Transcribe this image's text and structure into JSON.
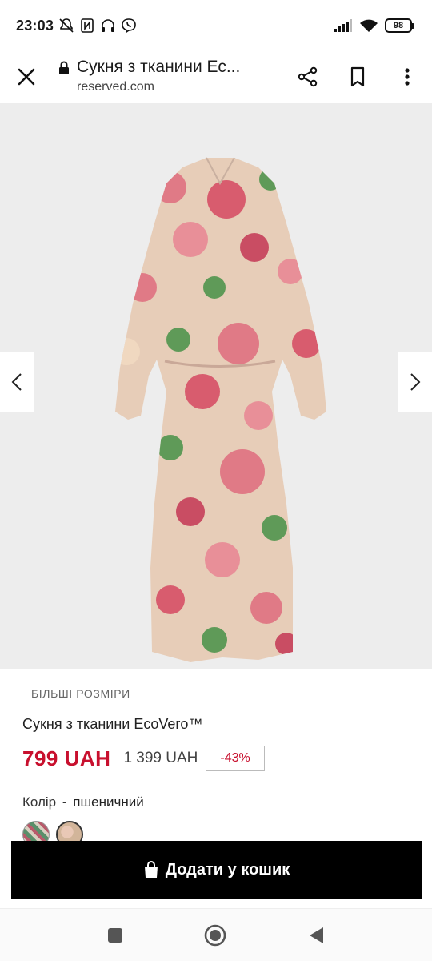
{
  "status_bar": {
    "time": "23:03",
    "battery": "98"
  },
  "browser": {
    "page_title": "Сукня з тканини Ес...",
    "domain": "reserved.com"
  },
  "product": {
    "category_label": "БІЛЬШІ РОЗМІРИ",
    "name": "Сукня з тканини EcoVero™",
    "price": "799 UAH",
    "old_price": "1 399 UAH",
    "discount": "-43%",
    "color_label": "Колір",
    "color_separator": "-",
    "color_value": "пшеничний"
  },
  "cart_button": {
    "label": "Додати у кошик"
  },
  "icons": {
    "close": "close-icon",
    "lock": "lock-icon",
    "share": "share-icon",
    "bookmark": "bookmark-icon",
    "more": "more-vertical-icon",
    "prev": "chevron-left-icon",
    "next": "chevron-right-icon",
    "bag": "shopping-bag-icon",
    "home_square": "recents-icon",
    "home_circle": "home-icon",
    "back_triangle": "back-icon"
  },
  "colors": {
    "price_red": "#c8102e",
    "button_black": "#000000",
    "gallery_bg": "#ededed"
  }
}
